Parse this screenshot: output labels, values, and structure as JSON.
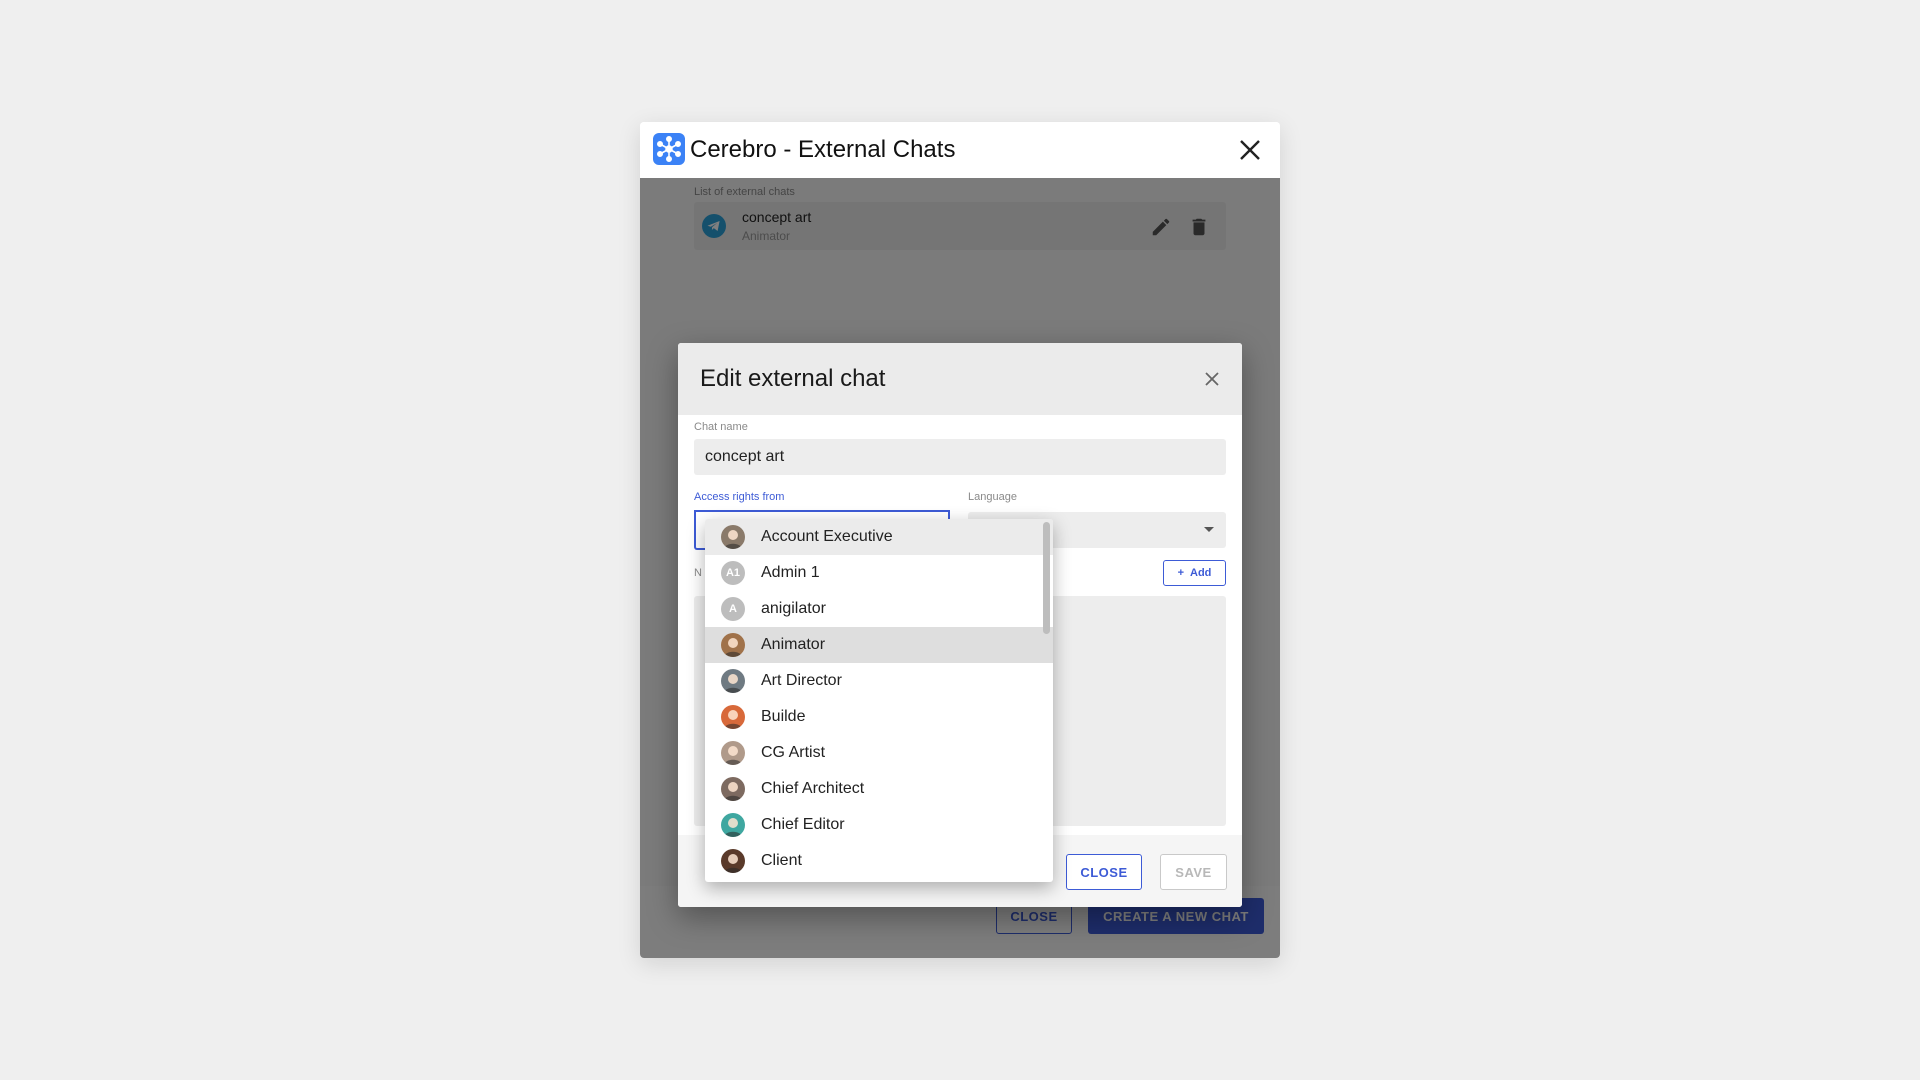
{
  "window": {
    "title": "Cerebro - External Chats"
  },
  "chat_list": {
    "caption": "List of external chats",
    "items": [
      {
        "name": "concept art",
        "role": "Animator",
        "icon": "telegram-icon"
      }
    ]
  },
  "footer": {
    "close_label": "CLOSE",
    "create_label": "CREATE A NEW CHAT"
  },
  "dialog": {
    "title": "Edit external chat",
    "chat_name_label": "Chat name",
    "chat_name_value": "concept art",
    "access_label": "Access rights from",
    "language_label": "Language",
    "notifications_label_partial": "N",
    "add_label": "Add",
    "close_label": "CLOSE",
    "save_label": "SAVE"
  },
  "dropdown": {
    "options": [
      {
        "label": "Account Executive",
        "avatar": "photo",
        "initials": "",
        "color": "#8a7a6a"
      },
      {
        "label": "Admin 1",
        "avatar": "initials",
        "initials": "A1",
        "color": "#bdbdbd"
      },
      {
        "label": "anigilator",
        "avatar": "initials",
        "initials": "A",
        "color": "#bdbdbd"
      },
      {
        "label": "Animator",
        "avatar": "photo",
        "initials": "",
        "color": "#a0724a"
      },
      {
        "label": "Art Director",
        "avatar": "photo",
        "initials": "",
        "color": "#6f7a82"
      },
      {
        "label": "Builde",
        "avatar": "photo",
        "initials": "",
        "color": "#d8693a"
      },
      {
        "label": "CG Artist",
        "avatar": "photo",
        "initials": "",
        "color": "#b09a8a"
      },
      {
        "label": "Chief Architect",
        "avatar": "photo",
        "initials": "",
        "color": "#7d6a60"
      },
      {
        "label": "Chief Editor",
        "avatar": "photo",
        "initials": "",
        "color": "#3fa7a0"
      },
      {
        "label": "Client",
        "avatar": "photo",
        "initials": "",
        "color": "#5a3a2a"
      }
    ],
    "hovered_index": 0,
    "selected_index": 3
  },
  "colors": {
    "accent": "#3d5bd6",
    "app_logo": "#3b82f6",
    "telegram": "#2aa0d8",
    "overlay": "rgba(0,0,0,0.5)"
  }
}
